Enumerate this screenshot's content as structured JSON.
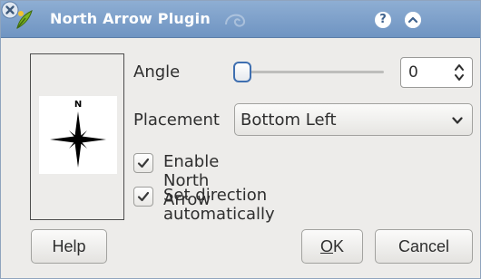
{
  "window": {
    "title": "North Arrow Plugin"
  },
  "titlebar": {
    "help_glyph": "?",
    "icons": [
      "plugin-leaf-icon",
      "help-icon",
      "shade-icon",
      "close-icon"
    ]
  },
  "preview": {
    "north_letter": "N"
  },
  "angle": {
    "label": "Angle",
    "slider_fraction": 0,
    "spin_value": "0"
  },
  "placement": {
    "label": "Placement",
    "selected": "Bottom Left"
  },
  "options": {
    "enable_label": "Enable North Arrow",
    "enable_checked": true,
    "auto_direction_label": "Set direction automatically",
    "auto_direction_checked": true
  },
  "buttons": {
    "help_label": "Help",
    "ok_mnemonic": "O",
    "ok_rest": "K",
    "cancel_label": "Cancel"
  },
  "colors": {
    "titlebar": "#7ea1cc",
    "window_bg": "#edecea",
    "slider_accent": "#3f6fb0"
  }
}
